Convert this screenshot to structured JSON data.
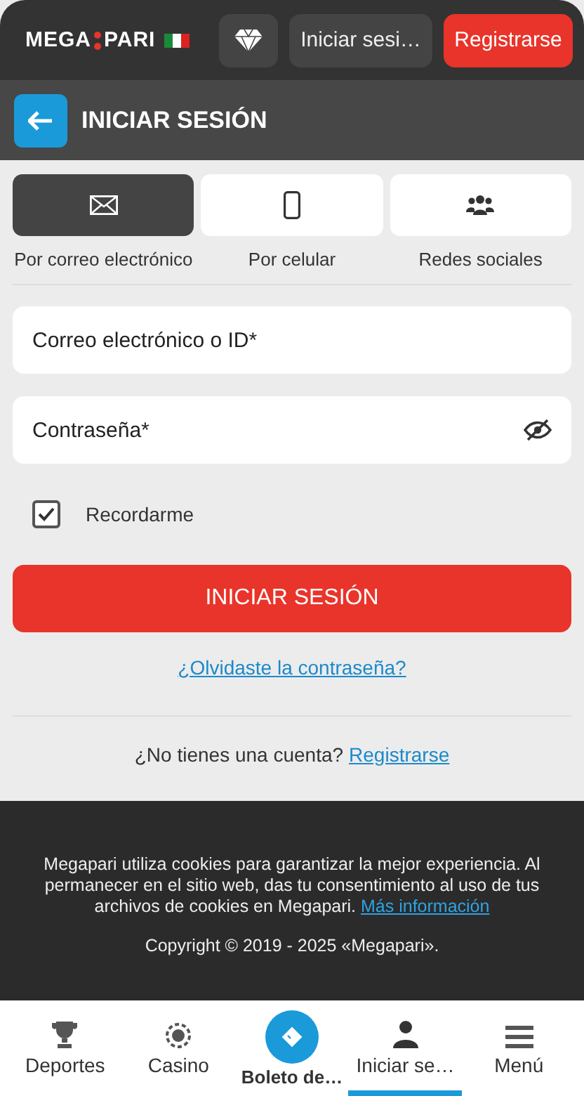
{
  "header": {
    "logo_left": "MEGA",
    "logo_right": "PARI",
    "login_button": "Iniciar sesi…",
    "register_button": "Registrarse"
  },
  "title_bar": {
    "title": "INICIAR SESIÓN"
  },
  "method_tabs": [
    {
      "kind": "email",
      "label": "Por correo electrónico",
      "selected": true
    },
    {
      "kind": "phone",
      "label": "Por celular",
      "selected": false
    },
    {
      "kind": "social",
      "label": "Redes sociales",
      "selected": false
    }
  ],
  "fields": [
    {
      "placeholder": "Correo electrónico o ID*",
      "kind": "text"
    },
    {
      "placeholder": "Contraseña*",
      "kind": "password"
    }
  ],
  "remember": {
    "label": "Recordarme",
    "checked": true
  },
  "submit": "INICIAR SESIÓN",
  "forgot_link": "¿Olvidaste la contraseña?",
  "signup": {
    "text": "¿No tienes una cuenta?",
    "link": "Registrarse"
  },
  "footer": {
    "notice": "Megapari utiliza cookies para garantizar la mejor experiencia. Al permanecer en el sitio web, das tu consentimiento al uso de tus archivos de cookies en Megapari.",
    "link": "Más información",
    "copyright": "Copyright © 2019 - 2025 «Megapari»."
  },
  "bottom_nav": [
    {
      "kind": "trophy",
      "label": "Deportes",
      "selected": false
    },
    {
      "kind": "chip",
      "label": "Casino",
      "selected": false
    },
    {
      "kind": "ticket",
      "label": "Boleto de…",
      "selected": false
    },
    {
      "kind": "user",
      "label": "Iniciar se…",
      "selected": true
    },
    {
      "kind": "menu",
      "label": "Menú",
      "selected": false
    }
  ]
}
